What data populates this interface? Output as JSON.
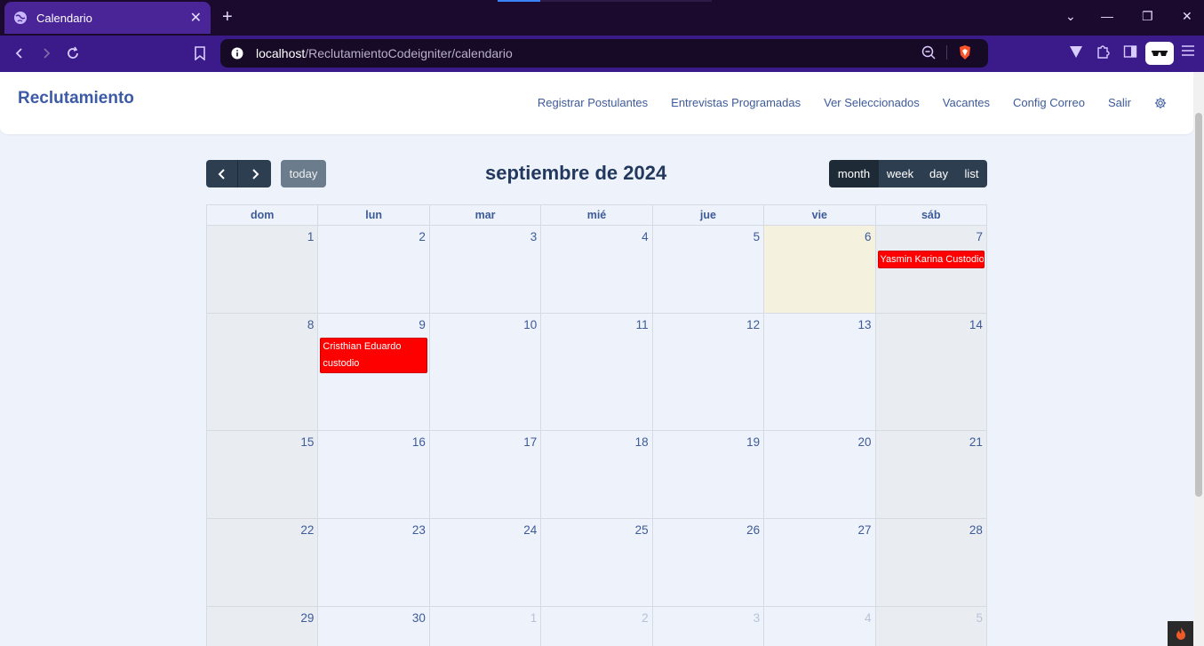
{
  "browser": {
    "tab_title": "Calendario",
    "url_host": "localhost",
    "url_path": "/ReclutamientoCodeigniter/calendario"
  },
  "app": {
    "brand": "Reclutamiento",
    "nav": [
      {
        "label": "Registrar Postulantes"
      },
      {
        "label": "Entrevistas Programadas"
      },
      {
        "label": "Ver Seleccionados"
      },
      {
        "label": "Vacantes"
      },
      {
        "label": "Config Correo"
      },
      {
        "label": "Salir"
      }
    ]
  },
  "calendar": {
    "title": "septiembre de 2024",
    "today_label": "today",
    "views": {
      "month": "month",
      "week": "week",
      "day": "day",
      "list": "list"
    },
    "dow": [
      "dom",
      "lun",
      "mar",
      "mié",
      "jue",
      "vie",
      "sáb"
    ],
    "weeks": [
      [
        "1",
        "2",
        "3",
        "4",
        "5",
        "6",
        "7"
      ],
      [
        "8",
        "9",
        "10",
        "11",
        "12",
        "13",
        "14"
      ],
      [
        "15",
        "16",
        "17",
        "18",
        "19",
        "20",
        "21"
      ],
      [
        "22",
        "23",
        "24",
        "25",
        "26",
        "27",
        "28"
      ],
      [
        "29",
        "30",
        "1",
        "2",
        "3",
        "4",
        "5"
      ]
    ],
    "events": {
      "sat7": "Yasmin Karina Custodio Ib",
      "mon9_line1": "Cristhian Eduardo",
      "mon9_line2": "custodio"
    }
  },
  "colors": {
    "event": "#ff0000",
    "today_cell": "#f4f2df",
    "weekend_cell": "#e9edf2",
    "accent": "#3c5aa6"
  }
}
